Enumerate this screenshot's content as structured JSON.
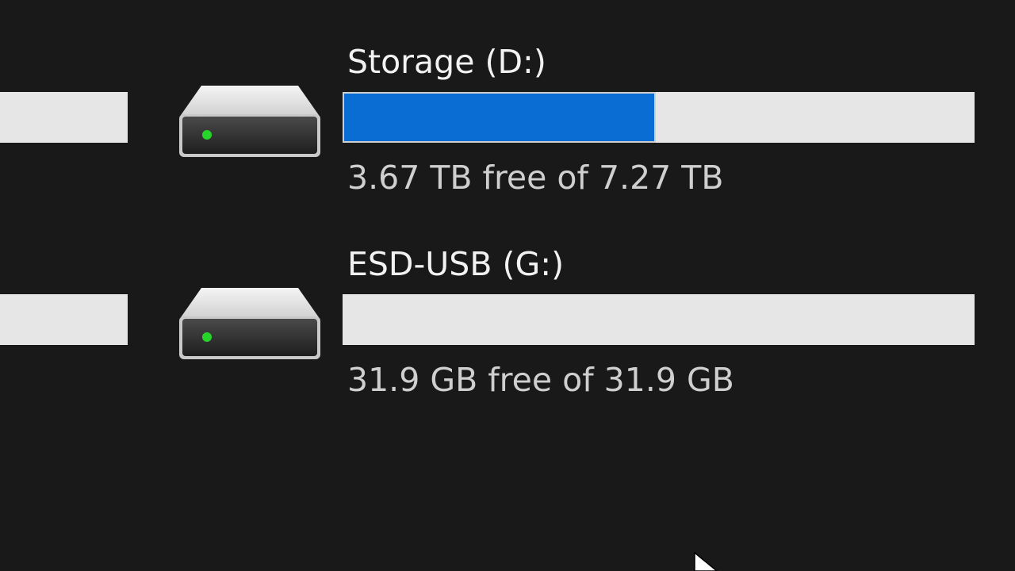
{
  "colors": {
    "background": "#191919",
    "bar_empty": "#e6e6e6",
    "bar_used": "#0a6dd4",
    "indicator_led": "#27d42a"
  },
  "drives": [
    {
      "icon": "hard-drive-icon",
      "title": "Storage (D:)",
      "usage_text": "3.67 TB free of 7.27 TB",
      "used_fraction": 0.4952
    },
    {
      "icon": "hard-drive-icon",
      "title": "ESD-USB (G:)",
      "usage_text": "31.9 GB free of 31.9 GB",
      "used_fraction": 0
    }
  ]
}
